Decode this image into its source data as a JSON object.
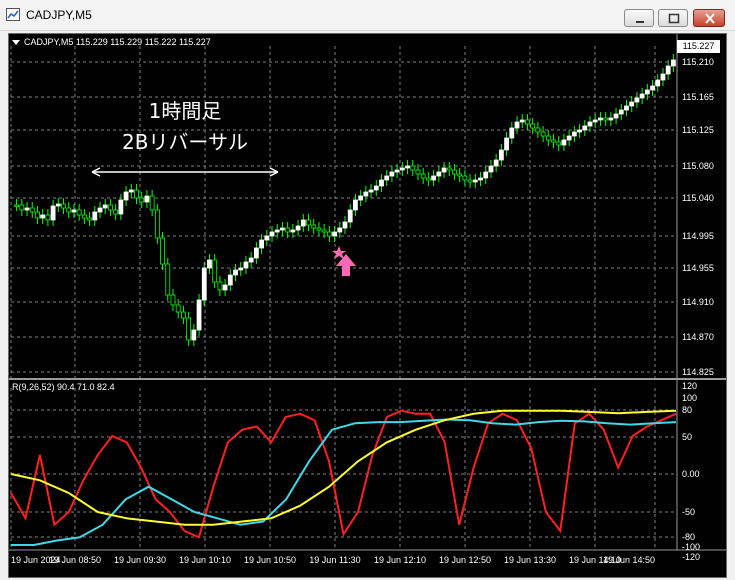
{
  "window": {
    "title": "CADJPY,M5"
  },
  "chart": {
    "symbol_info": "CADJPY,M5  115.229 115.229 115.222 115.227",
    "current_price": "115.227",
    "annotation_line1": "1時間足",
    "annotation_line2": "2Bリバーサル",
    "price_axis": [
      "115.210",
      "115.165",
      "115.125",
      "115.080",
      "115.040",
      "114.995",
      "114.955",
      "114.910",
      "114.870",
      "114.825"
    ],
    "time_axis": [
      "19 Jun 2024",
      "19 Jun 08:50",
      "19 Jun 09:30",
      "19 Jun 10:10",
      "19 Jun 10:50",
      "19 Jun 11:30",
      "19 Jun 12:10",
      "19 Jun 12:50",
      "19 Jun 13:30",
      "19 Jun 14:10",
      "19 Jun 14:50"
    ],
    "candle_color_up": "#ffffff",
    "candle_color_down": "#ffffff",
    "wick_color": "#00ff00",
    "grid_color": "#808080",
    "arrow_color": "#ff69b4",
    "star_color": "#ff69b4"
  },
  "indicator": {
    "info": "R(9,26,52) 90.4 71.0 82.4",
    "axis": [
      "120",
      "100",
      "80",
      "50",
      "0.00",
      "-50",
      "-80",
      "-100",
      "-120"
    ],
    "line_colors": {
      "fast": "#ff2020",
      "mid": "#40d8e8",
      "slow": "#ffff30"
    }
  },
  "chart_data": {
    "type": "line",
    "title": "",
    "series": [
      {
        "name": "",
        "values": [
          -30,
          -70,
          30,
          -80,
          -60,
          -10,
          30,
          60,
          50,
          10,
          -40,
          -60,
          -90,
          -100,
          -20,
          50,
          70,
          75,
          50,
          90,
          95,
          85,
          20,
          -95,
          -60,
          30,
          90,
          100,
          95,
          95,
          50,
          -80,
          10,
          80,
          95,
          85,
          40,
          -60,
          -90,
          80,
          95,
          70,
          10,
          60,
          75,
          85,
          95
        ]
      },
      {
        "name": "",
        "values": [
          -120,
          -115,
          -105,
          -100,
          -80,
          -40,
          -20,
          -40,
          -60,
          -70,
          -80,
          -75,
          -40,
          20,
          70,
          80,
          82,
          82,
          84,
          86,
          85,
          80,
          78,
          82,
          84,
          83,
          80,
          78,
          80,
          82
        ]
      },
      {
        "name": "",
        "values": [
          0,
          -10,
          -30,
          -60,
          -70,
          -75,
          -80,
          -80,
          -75,
          -70,
          -50,
          -20,
          20,
          50,
          70,
          85,
          95,
          100,
          100,
          100,
          98,
          96,
          98,
          100
        ]
      }
    ],
    "ylim": [
      -120,
      120
    ]
  }
}
